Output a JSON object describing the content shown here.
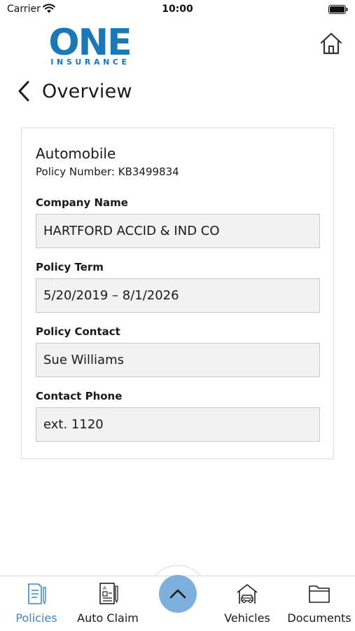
{
  "status_bar": {
    "carrier": "Carrier",
    "time": "10:00"
  },
  "header": {
    "logo_text": "ONE",
    "logo_subtext": "INSURANCE",
    "home_icon": "home-icon"
  },
  "nav": {
    "back_icon": "chevron-left-icon",
    "title": "Overview"
  },
  "policy": {
    "type": "Automobile",
    "policy_number_label": "Policy Number:",
    "policy_number": "KB3499834",
    "fields": [
      {
        "label": "Company Name",
        "value": "HARTFORD ACCID & IND CO"
      },
      {
        "label": "Policy Term",
        "value": "5/20/2019 – 8/1/2026"
      },
      {
        "label": "Policy Contact",
        "value": "Sue Williams"
      },
      {
        "label": "Contact Phone",
        "value": "ext. 1120"
      }
    ]
  },
  "tab_bar": {
    "tabs": [
      {
        "label": "Policies",
        "icon": "policy-document-icon",
        "active": true
      },
      {
        "label": "Auto Claim",
        "icon": "claim-form-icon",
        "active": false
      },
      {
        "label": "Vehicles",
        "icon": "car-garage-icon",
        "active": false
      },
      {
        "label": "Documents",
        "icon": "folder-icon",
        "active": false
      }
    ],
    "fab_icon": "chevron-up-icon"
  },
  "colors": {
    "brand_blue": "#1a77b8",
    "active_tab": "#3e86c6",
    "fab": "#7eb0dd",
    "field_bg": "#f2f2f2"
  }
}
